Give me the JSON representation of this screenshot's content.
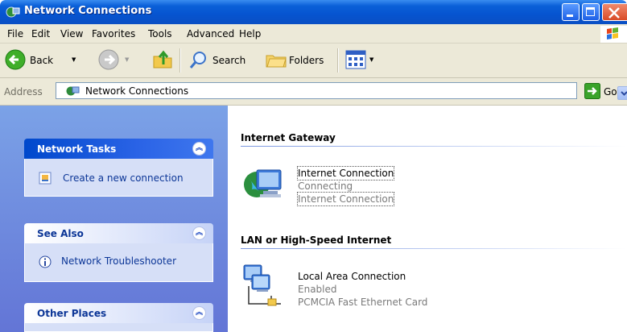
{
  "window": {
    "title": "Network Connections"
  },
  "menu": [
    "File",
    "Edit",
    "View",
    "Favorites",
    "Tools",
    "Advanced",
    "Help"
  ],
  "toolbar": {
    "back_label": "Back",
    "search_label": "Search",
    "folders_label": "Folders"
  },
  "address": {
    "label": "Address",
    "value": "Network Connections",
    "go_label": "Go"
  },
  "task_pane": {
    "network_tasks": {
      "title": "Network Tasks",
      "links": [
        "Create a new connection"
      ]
    },
    "see_also": {
      "title": "See Also",
      "links": [
        "Network Troubleshooter"
      ]
    },
    "other_places": {
      "title": "Other Places"
    }
  },
  "groups": [
    {
      "title": "Internet Gateway",
      "items": [
        {
          "name": "Internet Connection",
          "status": "Connecting",
          "detail": "Internet Connection"
        }
      ]
    },
    {
      "title": "LAN or High-Speed Internet",
      "items": [
        {
          "name": "Local Area Connection",
          "status": "Enabled",
          "detail": "PCMCIA Fast Ethernet Card"
        }
      ]
    }
  ],
  "colors": {
    "titlebar": "#0a5fd8",
    "taskpane_bg": "#6f8ede",
    "link": "#0c3697"
  }
}
